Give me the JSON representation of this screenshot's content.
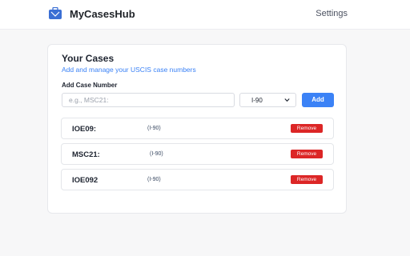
{
  "app": {
    "name": "MyCasesHub",
    "logo_icon": "briefcase-logo-icon"
  },
  "nav": {
    "settings_label": "Settings"
  },
  "cases_panel": {
    "title": "Your Cases",
    "subtitle": "Add and manage your USCIS case numbers",
    "add_label": "Add Case Number",
    "input_placeholder": "e.g., MSC21:",
    "form_select_value": "I-90",
    "add_button_label": "Add"
  },
  "cases": [
    {
      "case_number": "IOE09:",
      "form": "(I-90)",
      "remove_label": "Remove"
    },
    {
      "case_number": "MSC21:",
      "form": "(I-90)",
      "remove_label": "Remove"
    },
    {
      "case_number": "IOE092",
      "form": "(I-90)",
      "remove_label": "Remove"
    }
  ],
  "colors": {
    "accent": "#3b82f6",
    "danger": "#dc2626",
    "background": "#f7f7f8"
  }
}
